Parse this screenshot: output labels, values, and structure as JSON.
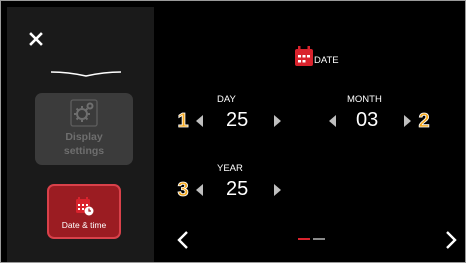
{
  "sidebar": {
    "tiles": [
      {
        "label": "Display settings",
        "active": false
      },
      {
        "label": "Date & time",
        "active": true
      }
    ]
  },
  "date_screen": {
    "title": "DATE",
    "fields": [
      {
        "badge": "1",
        "label": "DAY",
        "value": "25"
      },
      {
        "badge": "2",
        "label": "MONTH",
        "value": "03"
      },
      {
        "badge": "3",
        "label": "YEAR",
        "value": "25"
      }
    ]
  },
  "pagination": {
    "current_page": 1,
    "total_pages": 2
  },
  "colors": {
    "accent": "#d9232d",
    "badge": "#f5a91d",
    "active_tile": "#9b1c22",
    "inactive_tile": "#3b3b3b"
  },
  "icons": [
    "close-icon",
    "gear-icon",
    "calendar-icon",
    "chevron-left-icon",
    "chevron-right-icon"
  ]
}
